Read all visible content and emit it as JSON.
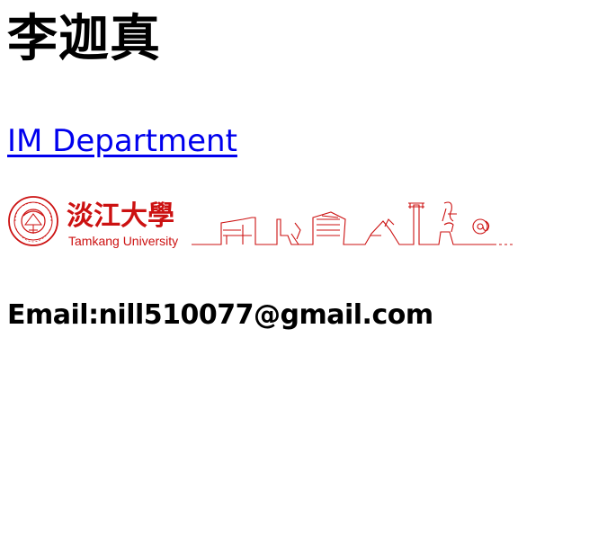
{
  "profile": {
    "name": "李迦真",
    "department_link": "IM Department",
    "email_text": "Email:nill510077@gmail.com"
  },
  "logo": {
    "chinese_name": "淡江大學",
    "english_name": "Tamkang University",
    "color": "#cc1111"
  },
  "colors": {
    "link": "#0000ee",
    "text": "#000000",
    "background": "#ffffff"
  }
}
